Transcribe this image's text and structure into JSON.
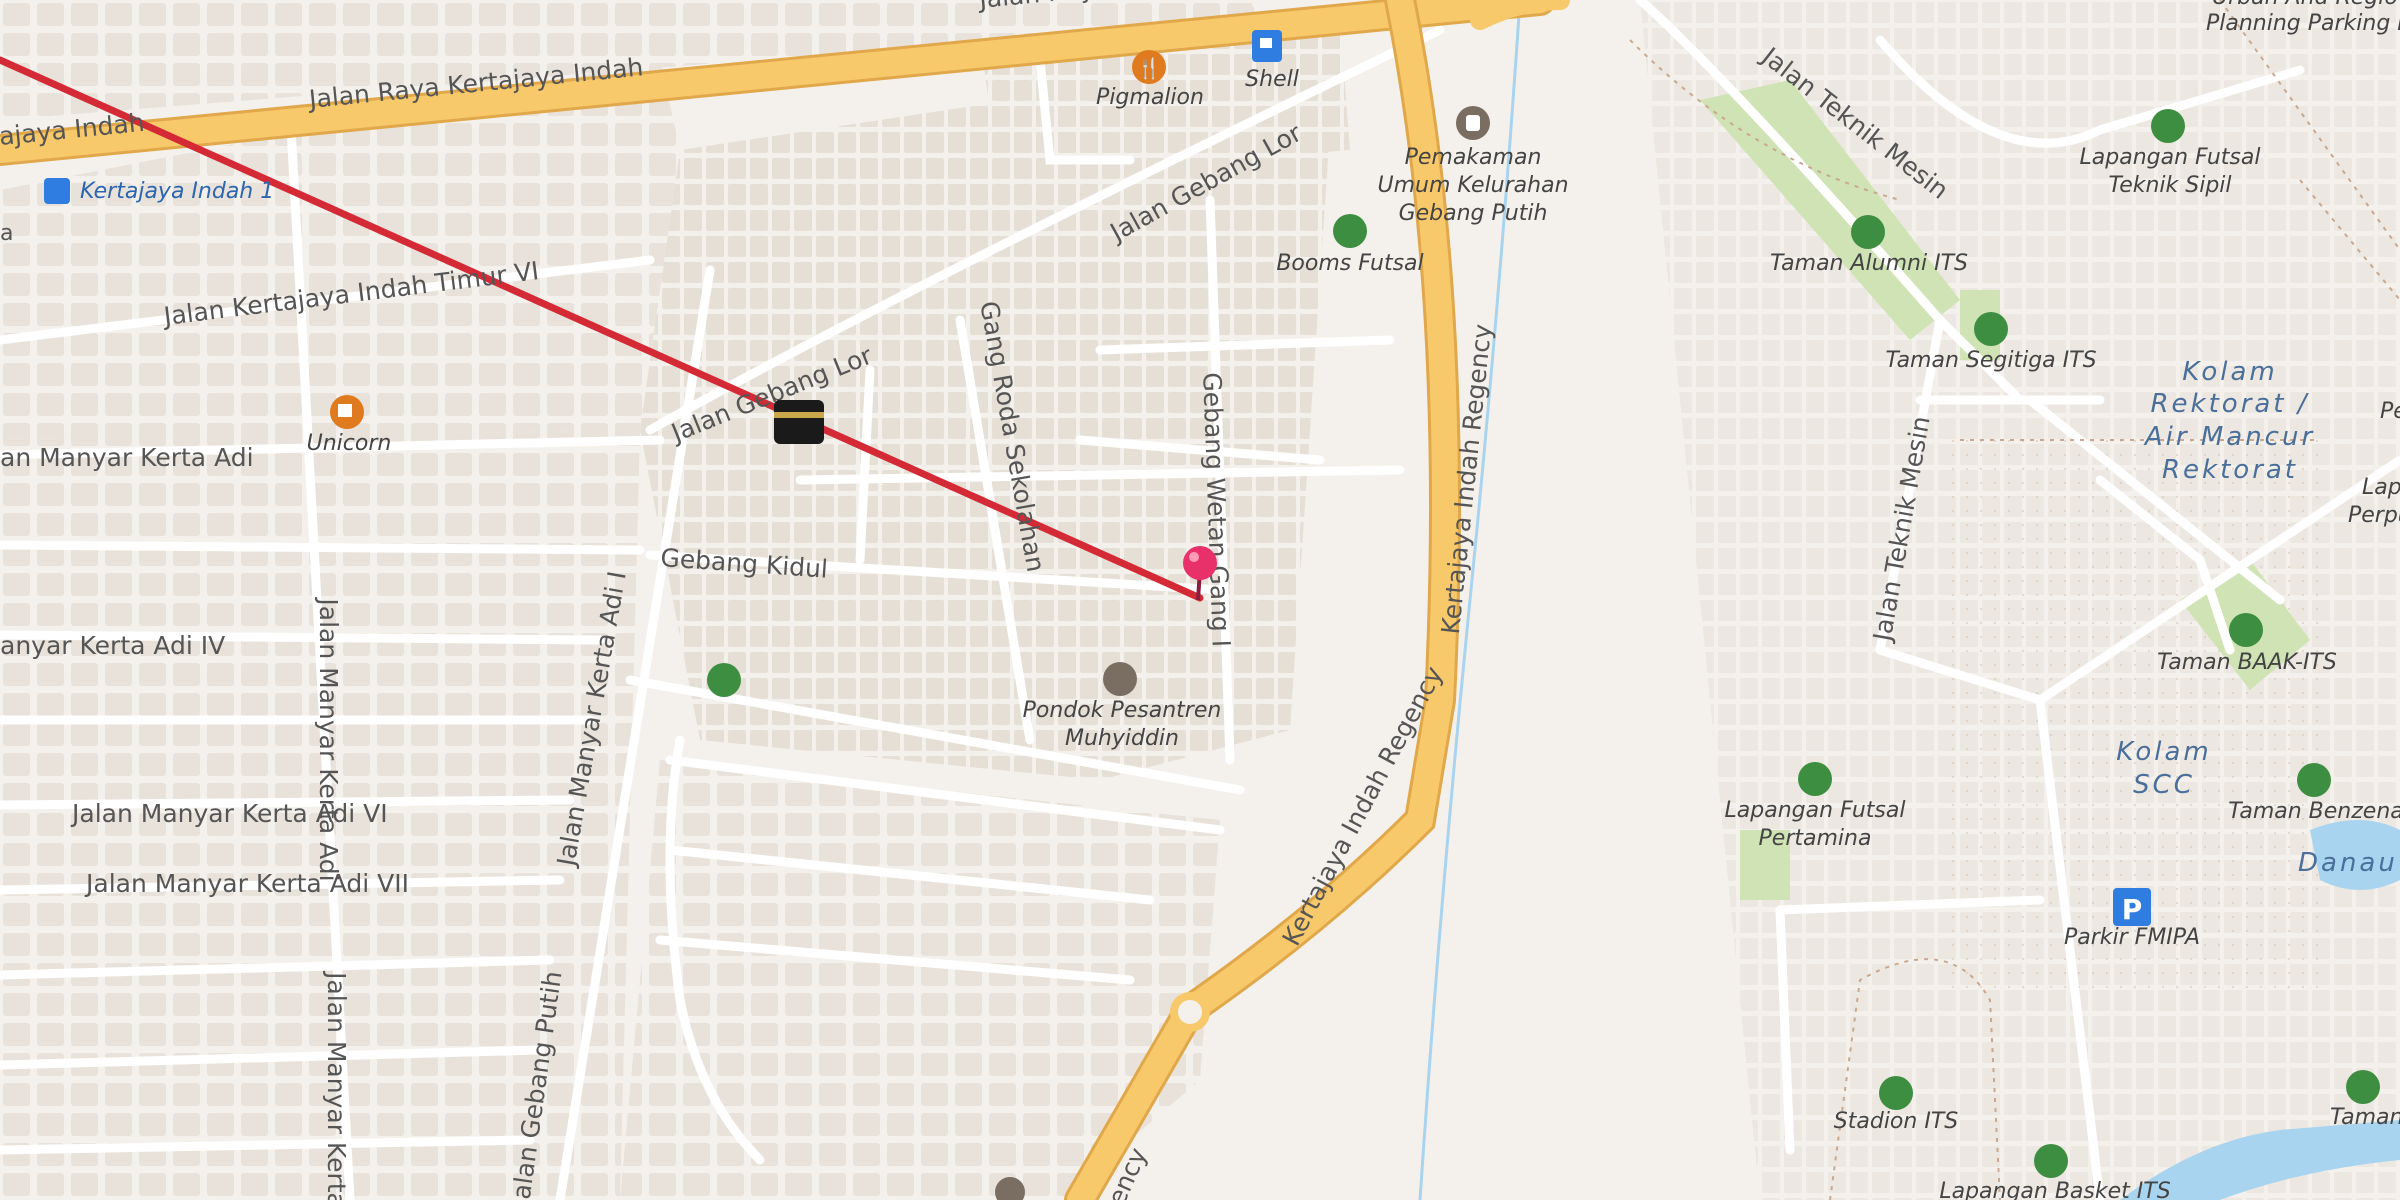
{
  "map": {
    "streets": {
      "raya_kertajaya_indah": "Jalan Raya Kertajaya Indah",
      "raya_top": "Jalan Ray",
      "kertajaya_indah_left": "ajaya Indah",
      "kertajaya_indah_timur_vi": "Jalan Kertajaya Indah Timur VI",
      "manyar_kerta_adi": "an Manyar Kerta Adi",
      "manyar_kerta_adi_iv": "anyar Kerta Adi IV",
      "manyar_kerta_adi_vi": "Jalan Manyar Kerta Adi VI",
      "manyar_kerta_adi_vii": "Jalan Manyar Kerta Adi VII",
      "manyar_kerta_adi_vertical": "Jalan Manyar Kerta Adi",
      "manyar_kerta_adi_vertical_bottom": "Jalan Manyar Kerta",
      "manyar_kerta_adi_i": "Jalan Manyar Kerta Adi I",
      "gebang_putih": "Jalan Gebang Putih",
      "gebang_lor": "Jalan Gebang Lor",
      "gebang_lor_left": "Jalan Gebang Lor",
      "gebang_kidul": "Gebang Kidul",
      "gang_roda_sekolahan": "Gang Roda Sekolahan",
      "gebang_wetan_gang_i": "Gebang Wetan Gang I",
      "kertajaya_indah_regency_1": "Kertajaya Indah Regency",
      "kertajaya_indah_regency_2": "Kertajaya Indah Regency",
      "kertajaya_indah_regency_3": "ency",
      "teknik_mesin_1": "Jalan Teknik Mesin",
      "teknik_mesin_2": "Jalan Teknik Mesin"
    },
    "pois": {
      "shell": "Shell",
      "pigmalion": "Pigmalion",
      "unicorn": "Unicorn",
      "pemakaman": [
        "Pemakaman",
        "Umum Kelurahan",
        "Gebang Putih"
      ],
      "booms_futsal": "Booms Futsal",
      "pondok": [
        "Pondok Pesantren",
        "Muhyiddin"
      ],
      "taman_alumni": "Taman Alumni ITS",
      "taman_segitiga": "Taman Segitiga ITS",
      "lapangan_teknik_sipil": [
        "Lapangan Futsal",
        "Teknik Sipil"
      ],
      "taman_baak": "Taman BAAK-ITS",
      "lapangan_pertamina": [
        "Lapangan Futsal",
        "Pertamina"
      ],
      "parkir_fmipa": "Parkir FMIPA",
      "taman_benzena": "Taman Benzena",
      "stadion": "Stadion ITS",
      "lapangan_basket": "Lapangan Basket ITS",
      "taman_stati": "Taman Stati",
      "planning_parking": [
        "Urban And Regio",
        "Planning Parking L"
      ],
      "perpus": [
        "Lap",
        "Perpust"
      ],
      "pe": "Pe"
    },
    "areas": {
      "kolam_rektorat": [
        "Kolam",
        "Rektorat /",
        "Air Mancur",
        "Rektorat"
      ],
      "kolam_scc": [
        "Kolam",
        "SCC"
      ],
      "danau": "Danau"
    },
    "transit": {
      "bus_stop": "Kertajaya Indah 1"
    },
    "edge": {
      "left_fragment": "a"
    },
    "colors": {
      "route": "#d42a35",
      "major_road": "#f7c96a",
      "major_road_casing": "#e0a84a",
      "park": "#cfe3b4",
      "water": "#a9d4ef",
      "pin": "#e8316b",
      "icon_green": "#3e8e41",
      "icon_orange": "#e07a1f",
      "icon_blue": "#2f7de1"
    }
  }
}
